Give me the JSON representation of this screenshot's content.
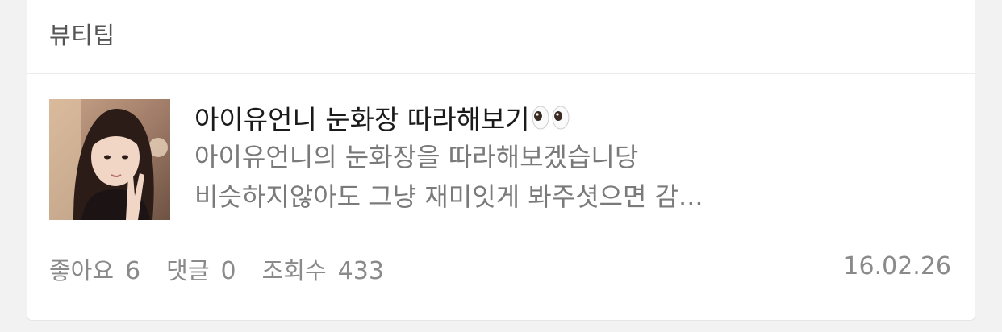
{
  "category": "뷰티팁",
  "post": {
    "title": "아이유언니 눈화장 따라해보기",
    "title_emoji": "eyes-emoji",
    "excerpt_lines": [
      "아이유언니의 눈화장을 따라해보겠습니당",
      "비슷하지않아도 그냥 재미잇게 봐주셧으면 감..."
    ],
    "thumbnail": "post-thumbnail-photo"
  },
  "stats": {
    "likes_label": "좋아요",
    "likes": "6",
    "comments_label": "댓글",
    "comments": "0",
    "views_label": "조회수",
    "views": "433"
  },
  "date": "16.02.26"
}
